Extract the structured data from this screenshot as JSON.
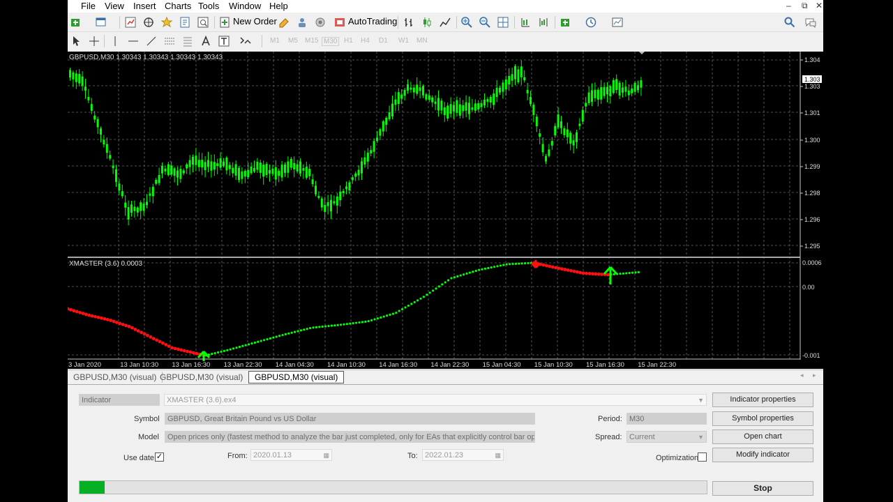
{
  "menu": [
    "File",
    "View",
    "Insert",
    "Charts",
    "Tools",
    "Window",
    "Help"
  ],
  "toolbar": {
    "new_order": "New Order",
    "autotrading": "AutoTrading"
  },
  "timeframes": [
    "M1",
    "M5",
    "M15",
    "M30",
    "H1",
    "H4",
    "D1",
    "W1",
    "MN"
  ],
  "chart": {
    "price_header": "GBPUSD,M30  1.30343 1.30343 1.30343 1.30343",
    "price_label": "1.303",
    "price_ticks": [
      "1.304",
      "1.303",
      "1.301",
      "1.300",
      "1.299",
      "1.298",
      "1.296",
      "1.295"
    ],
    "indicator_header": "XMASTER (3.6) 0.0003",
    "indicator_ticks": [
      "0.0006",
      "0.00",
      "-0.001"
    ],
    "time_ticks": [
      "3 Jan 2020",
      "13 Jan 10:30",
      "13 Jan 16:30",
      "13 Jan 22:30",
      "14 Jan 04:30",
      "14 Jan 10:30",
      "14 Jan 16:30",
      "14 Jan 22:30",
      "15 Jan 04:30",
      "15 Jan 10:30",
      "15 Jan 16:30",
      "15 Jan 22:30"
    ],
    "colors": {
      "bull": "#00ff00",
      "bear": "#ff1010",
      "candle": "#00ff00",
      "grid": "#6b6b6b"
    }
  },
  "tabs": [
    "GBPUSD,M30 (visual)",
    "GBPUSD,M30 (visual)",
    "GBPUSD,M30 (visual)"
  ],
  "tester": {
    "type_label": "Indicator",
    "indicator_value": "XMASTER (3.6).ex4",
    "symbol_label": "Symbol",
    "symbol_value": "GBPUSD, Great Britain Pound vs US Dollar",
    "model_label": "Model",
    "model_value": "Open prices only (fastest method to analyze the bar just completed, only for EAs that explicitly control bar openin",
    "use_date_label": "Use date",
    "use_date_checked": true,
    "from_label": "From:",
    "from_value": "2020.01.13",
    "to_label": "To:",
    "to_value": "2022.01.23",
    "period_label": "Period:",
    "period_value": "M30",
    "spread_label": "Spread:",
    "spread_value": "Current",
    "optimization_label": "Optimization",
    "buttons": {
      "indicator_properties": "Indicator properties",
      "symbol_properties": "Symbol properties",
      "open_chart": "Open chart",
      "modify_indicator": "Modify indicator",
      "stop": "Stop"
    },
    "progress_percent": 4
  }
}
